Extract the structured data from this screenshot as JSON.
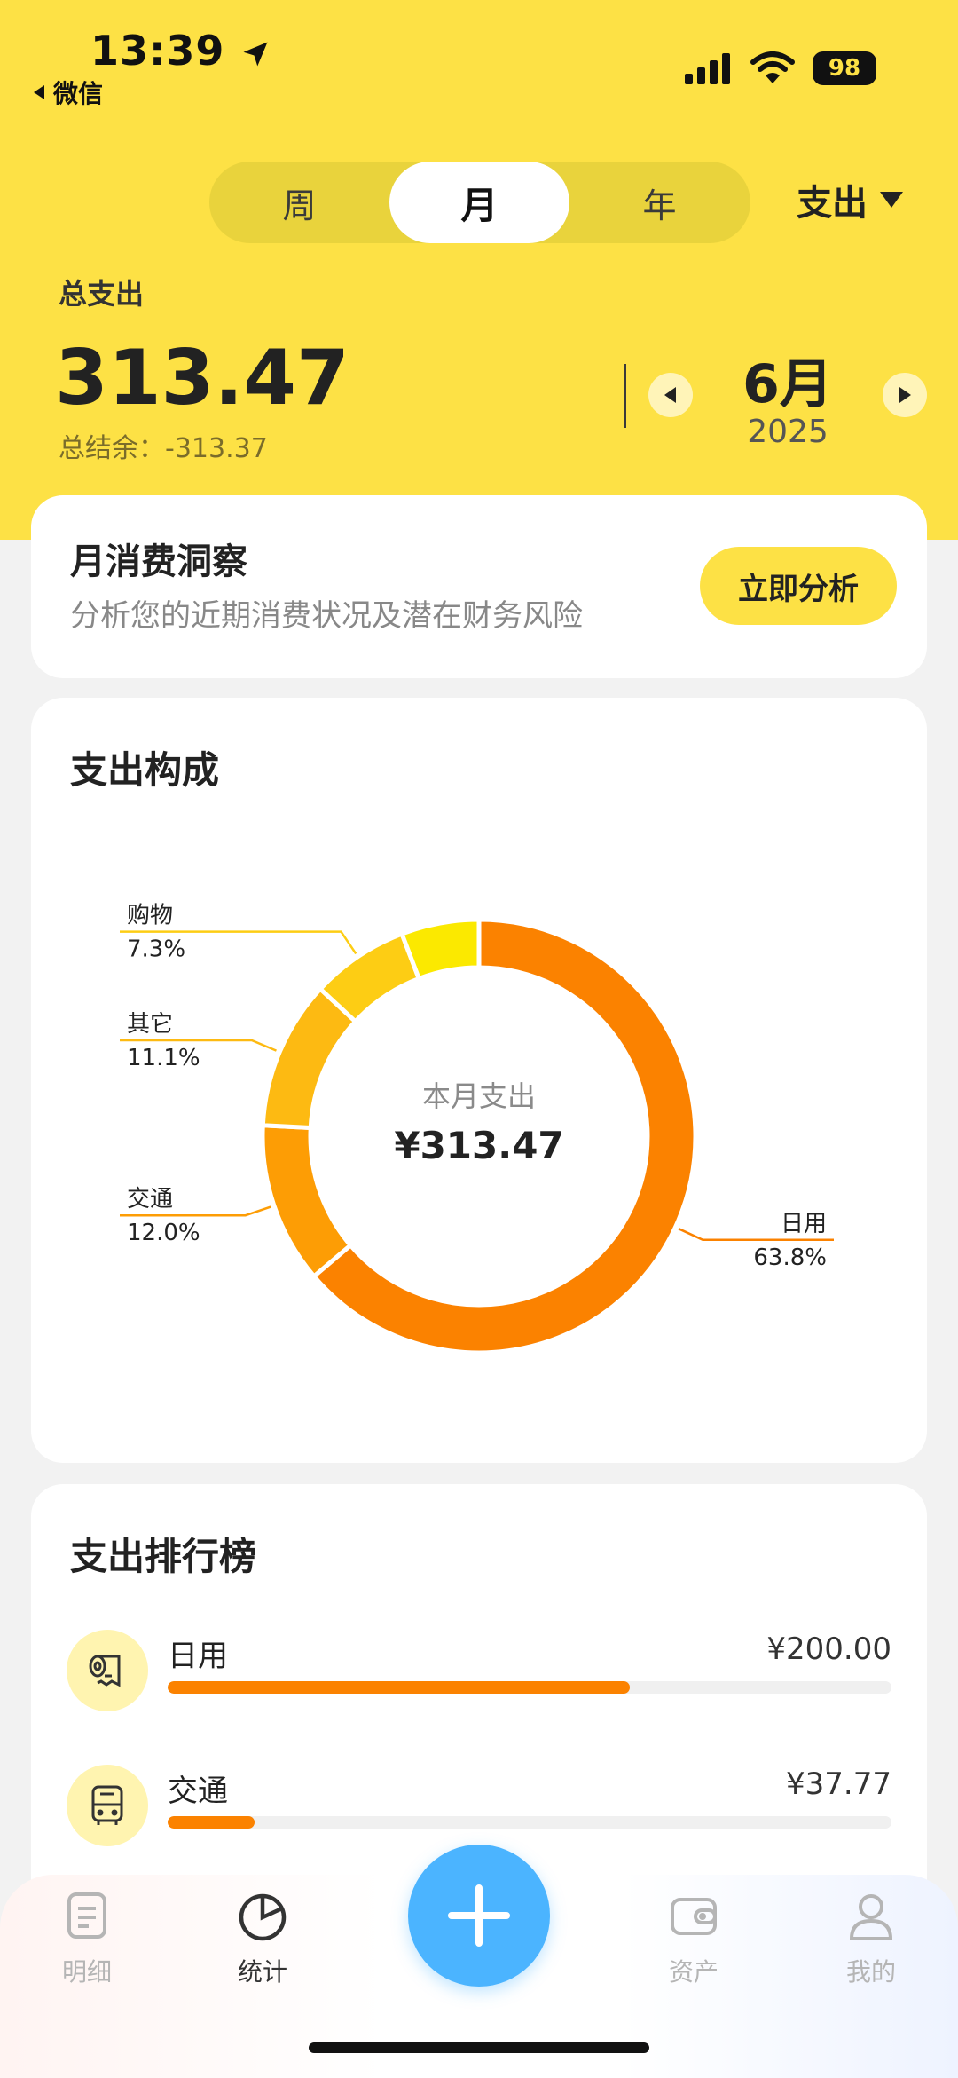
{
  "status_bar": {
    "time": "13:39",
    "back_app": "微信",
    "battery": "98"
  },
  "period_tabs": [
    {
      "label": "周",
      "active": false
    },
    {
      "label": "月",
      "active": true
    },
    {
      "label": "年",
      "active": false
    }
  ],
  "type_select": {
    "label": "支出"
  },
  "summary": {
    "total_label": "总支出",
    "total_value": "313.47",
    "balance_text": "总结余：-313.37",
    "month": "6月",
    "year": "2025"
  },
  "insight": {
    "title": "月消费洞察",
    "description": "分析您的近期消费状况及潜在财务风险",
    "button": "立即分析"
  },
  "composition": {
    "title": "支出构成",
    "center_label": "本月支出",
    "center_value": "¥313.47"
  },
  "chart_data": {
    "type": "pie",
    "style": "donut",
    "categories": [
      "日用",
      "交通",
      "其它",
      "购物",
      ""
    ],
    "values": [
      63.8,
      12.0,
      11.1,
      7.3,
      5.8
    ],
    "labels": [
      "63.8%",
      "12.0%",
      "11.1%",
      "7.3%",
      ""
    ],
    "colors": [
      "#fb8200",
      "#fd9d05",
      "#fdba12",
      "#fdcd14",
      "#fbe900"
    ]
  },
  "ranking": {
    "title": "支出排行榜",
    "items": [
      {
        "name": "日用",
        "amount": "¥200.00",
        "share": 0.638,
        "icon": "toilet-paper-icon"
      },
      {
        "name": "交通",
        "amount": "¥37.77",
        "share": 0.12,
        "icon": "bus-icon"
      }
    ]
  },
  "tab_bar": {
    "items": [
      {
        "label": "明细",
        "icon": "list-icon",
        "active": false
      },
      {
        "label": "统计",
        "icon": "pie-chart-icon",
        "active": true
      },
      {
        "label": "资产",
        "icon": "wallet-icon",
        "active": false
      },
      {
        "label": "我的",
        "icon": "person-icon",
        "active": false
      }
    ],
    "add_icon": "plus-icon"
  }
}
